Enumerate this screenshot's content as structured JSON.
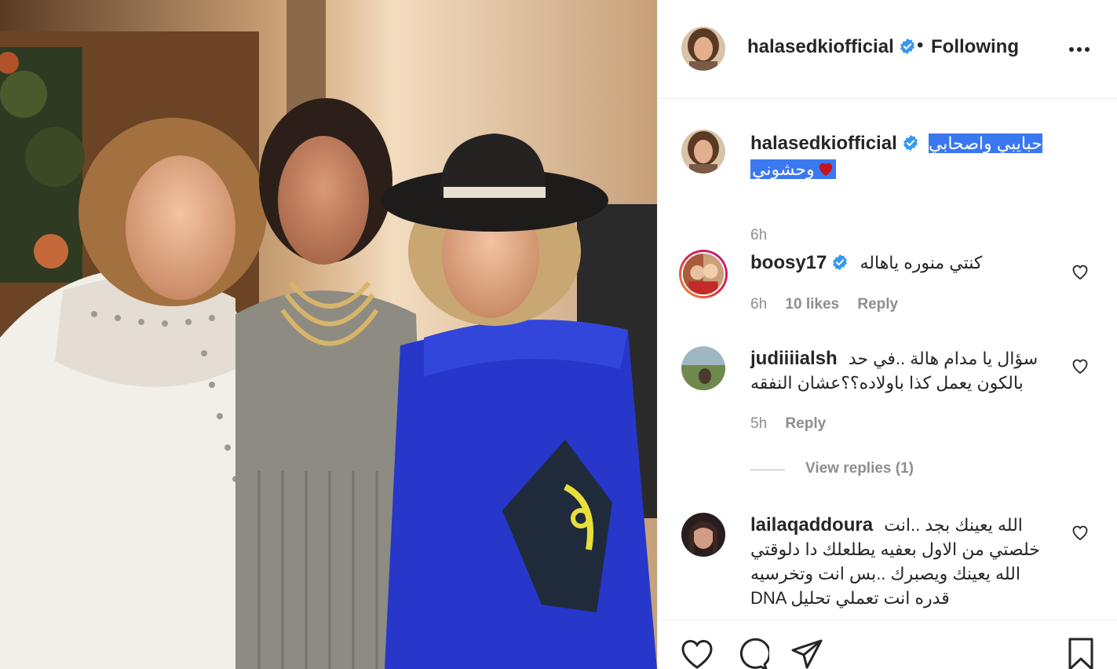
{
  "post": {
    "username": "halasedkiofficial",
    "verified": true,
    "follow_status": "Following",
    "separator": "•",
    "caption": "حبايبي واصحابي وحشوني",
    "caption_line1": "حبايبي واصحابي",
    "caption_line2": "وحشوني",
    "caption_emoji": "red-heart",
    "time": "6h"
  },
  "comments": [
    {
      "username": "boosy17",
      "verified": true,
      "text": "كنتي منوره ياهاله",
      "time": "6h",
      "likes": "10 likes",
      "reply": "Reply"
    },
    {
      "username": "judiiiialsh",
      "verified": false,
      "text": "سؤال يا مدام هالة ..في حد بالكون يعمل كذا باولاده؟؟عشان النفقه",
      "time": "5h",
      "reply": "Reply",
      "view_replies": "View replies (1)"
    },
    {
      "username": "lailaqaddoura",
      "verified": false,
      "text": "الله يعينك بجد ..انت خلصتي من الاول بعفيه يطلعلك دا دلوقتي الله يعينك ويصبرك ..بس انت وتخرسيه DNA قدره انت تعملي تحليل"
    }
  ],
  "icons": {
    "more": "more-options-icon",
    "verified": "verified-badge-icon",
    "like": "heart-icon",
    "comment": "comment-icon",
    "share": "share-icon",
    "save": "bookmark-icon"
  },
  "colors": {
    "verified": "#3897f0",
    "selection": "#3a78f0",
    "text": "#262626",
    "muted": "#8e8e8e",
    "border": "#efefef",
    "story_ring": "#d6249f"
  }
}
